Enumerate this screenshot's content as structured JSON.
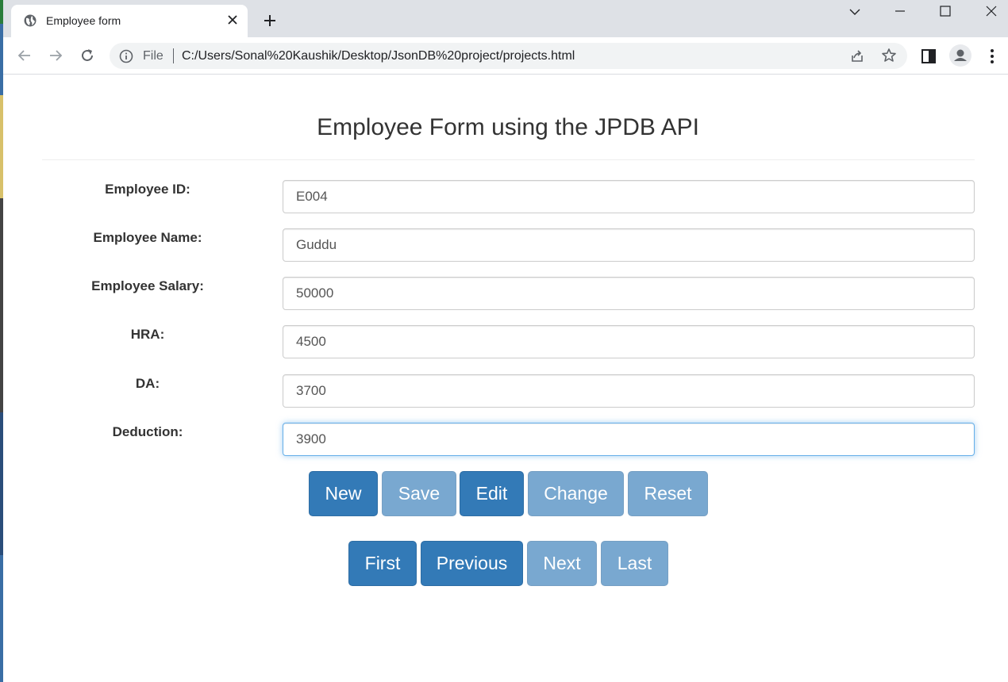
{
  "browser": {
    "tab_title": "Employee form",
    "address_prefix": "File",
    "url": "C:/Users/Sonal%20Kaushik/Desktop/JsonDB%20project/projects.html"
  },
  "page": {
    "title": "Employee Form using the JPDB API"
  },
  "form": {
    "fields": [
      {
        "label": "Employee ID:",
        "value": "E004"
      },
      {
        "label": "Employee Name:",
        "value": "Guddu"
      },
      {
        "label": "Employee Salary:",
        "value": "50000"
      },
      {
        "label": "HRA:",
        "value": "4500"
      },
      {
        "label": "DA:",
        "value": "3700"
      },
      {
        "label": "Deduction:",
        "value": "3900"
      }
    ]
  },
  "actions": {
    "new": "New",
    "save": "Save",
    "edit": "Edit",
    "change": "Change",
    "reset": "Reset"
  },
  "navigation": {
    "first": "First",
    "previous": "Previous",
    "next": "Next",
    "last": "Last"
  },
  "colors": {
    "primary": "#337ab7",
    "chrome_bg": "#dee1e6",
    "focus_border": "#66afe9"
  }
}
